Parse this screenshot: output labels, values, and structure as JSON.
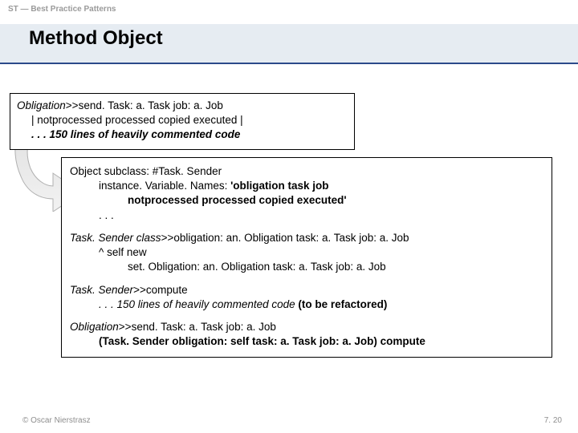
{
  "breadcrumb": "ST — Best Practice Patterns",
  "title": "Method Object",
  "box1": {
    "l1_a": "Obligation",
    "l1_b": ">>send. Task: a. Task job: a. Job",
    "l2": "| notprocessed processed copied executed |",
    "l3_a": ". . . 150 lines of heavily commented code"
  },
  "box2": {
    "s1_l1": "Object subclass: #Task. Sender",
    "s1_l2": "instance. Variable. Names: ",
    "s1_l2b": "'obligation task job",
    "s1_l3": "notprocessed processed copied executed'",
    "s1_l4": ". . .",
    "s2_l1a": "Task. Sender class",
    "s2_l1b": ">>obligation: an. Obligation task: a. Task job: a. Job",
    "s2_l2": "^ self new",
    "s2_l3": "set. Obligation: an. Obligation task: a. Task job: a. Job",
    "s3_l1a": "Task. Sender",
    "s3_l1b": ">>compute",
    "s3_l2a": ". . . 150 lines of heavily commented code ",
    "s3_l2b": "(to be refactored)",
    "s4_l1a": "Obligation",
    "s4_l1b": ">>send. Task: a. Task job: a. Job",
    "s4_l2": "(Task. Sender obligation: self task: a. Task job: a. Job) compute"
  },
  "footer": {
    "left": "© Oscar Nierstrasz",
    "right": "7. 20"
  }
}
